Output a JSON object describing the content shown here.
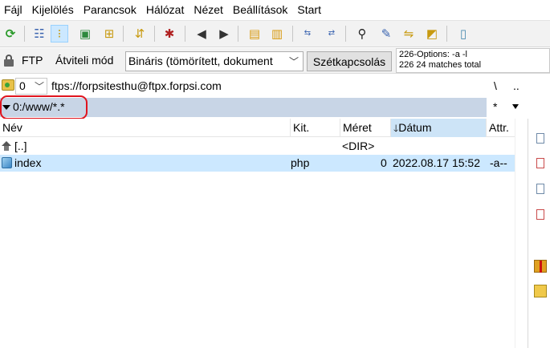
{
  "menu": [
    "Fájl",
    "Kijelölés",
    "Parancsok",
    "Hálózat",
    "Nézet",
    "Beállítások",
    "Start"
  ],
  "connection": {
    "protocol_label": "FTP",
    "transfer_mode_label": "Átviteli mód",
    "transfer_mode_value": "Bináris (tömörített, dokument",
    "disconnect_label": "Szétkapcsolás",
    "log_lines": [
      "226-Options: -a -l",
      "226 24 matches total"
    ]
  },
  "drive": {
    "selected": "0",
    "server_path": "ftps://forpsitesthu@ftpx.forpsi.com",
    "root_btn": "\\",
    "up_btn": ".."
  },
  "path": {
    "current": "0:/www/*.*",
    "filter_btn": "*"
  },
  "file_list": {
    "columns": {
      "name": "Név",
      "ext": "Kit.",
      "size": "Méret",
      "date": "Dátum",
      "attr": "Attr."
    },
    "rows": [
      {
        "name": "[..]",
        "ext": "",
        "size": "<DIR>",
        "date": "",
        "attr": ""
      },
      {
        "name": "index",
        "ext": "php",
        "size": "0",
        "date": "2022.08.17 15:52",
        "attr": "-a--"
      }
    ]
  },
  "colors": {
    "path_bar": "#c8d5e6",
    "selection": "#cce8ff",
    "highlight_oval": "#e0141e"
  }
}
